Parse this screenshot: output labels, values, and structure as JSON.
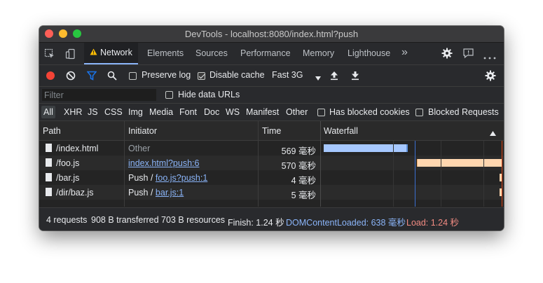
{
  "window": {
    "title": "DevTools - localhost:8080/index.html?push"
  },
  "tabs": {
    "items": [
      "Network",
      "Elements",
      "Sources",
      "Performance",
      "Memory",
      "Lighthouse"
    ],
    "more": "»",
    "active": "Network"
  },
  "toolbar": {
    "preserve_log": "Preserve log",
    "preserve_log_checked": false,
    "disable_cache": "Disable cache",
    "disable_cache_checked": true,
    "throttle": "Fast 3G"
  },
  "filter": {
    "placeholder": "Filter",
    "hide_data_urls": "Hide data URLs",
    "hide_data_urls_checked": false
  },
  "types": {
    "items": [
      "All",
      "XHR",
      "JS",
      "CSS",
      "Img",
      "Media",
      "Font",
      "Doc",
      "WS",
      "Manifest",
      "Other"
    ],
    "active": "All",
    "blocked_cookies": "Has blocked cookies",
    "blocked_requests": "Blocked Requests"
  },
  "table": {
    "columns": {
      "path": "Path",
      "initiator": "Initiator",
      "time": "Time",
      "waterfall": "Waterfall"
    },
    "rows": [
      {
        "path": "/index.html",
        "initiator_prefix": "",
        "initiator": "Other",
        "initiator_link": false,
        "time": "569 毫秒"
      },
      {
        "path": "/foo.js",
        "initiator_prefix": "",
        "initiator": "index.html?push:6",
        "initiator_link": true,
        "time": "570 毫秒"
      },
      {
        "path": "/bar.js",
        "initiator_prefix": "Push / ",
        "initiator": "foo.js?push:1",
        "initiator_link": true,
        "time": "4 毫秒"
      },
      {
        "path": "/dir/baz.js",
        "initiator_prefix": "Push / ",
        "initiator": "bar.js:1",
        "initiator_link": true,
        "time": "5 毫秒"
      }
    ]
  },
  "status": {
    "requests": "4 requests",
    "transferred": "908 B transferred",
    "resources": "703 B resources",
    "finish": "Finish: 1.24 秒",
    "dcl": "DOMContentLoaded: 638 毫秒",
    "load": "Load: 1.24 秒"
  },
  "colors": {
    "accent": "#8ab4f8",
    "record": "#f44336",
    "filter_icon": "#1a73e8",
    "bar_html": "#a6c8ff",
    "bar_script": "#ffd7b0",
    "warning": "#fbbc04"
  }
}
